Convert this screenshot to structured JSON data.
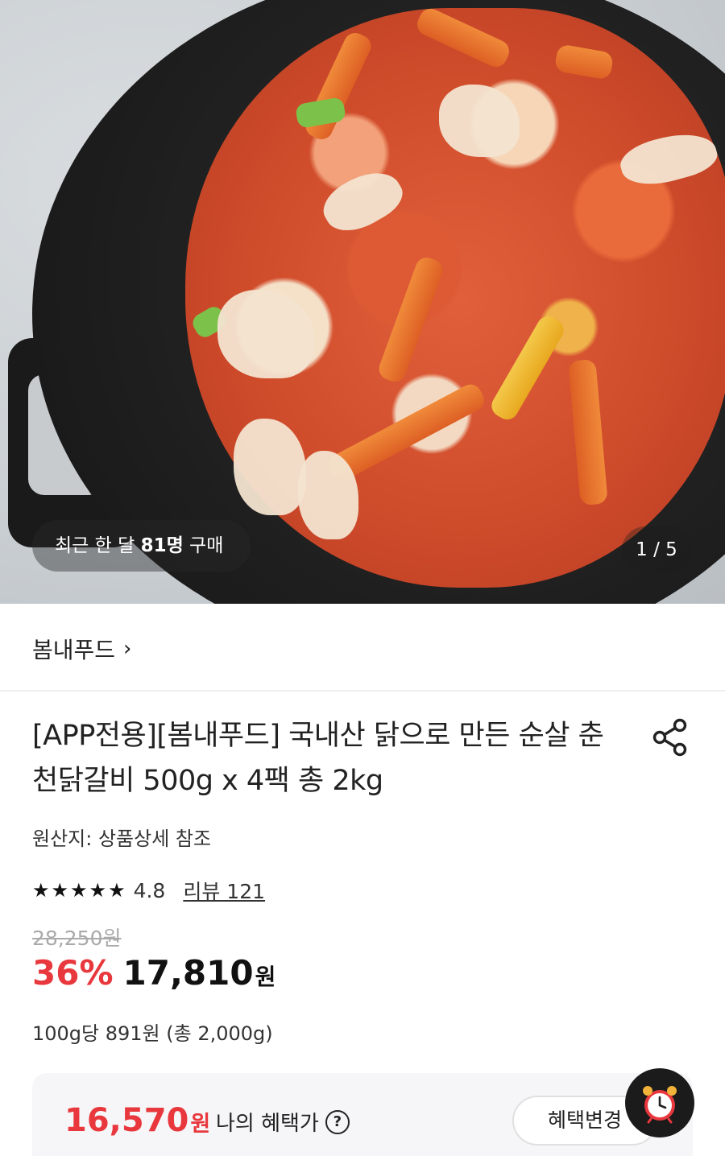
{
  "gallery": {
    "buyers_prefix": "최근 한 달 ",
    "buyers_count": "81명",
    "buyers_suffix": " 구매",
    "page_indicator": "1 / 5"
  },
  "seller": {
    "name": "봄내푸드",
    "chevron": "›"
  },
  "product": {
    "title": "[APP전용][봄내푸드] 국내산 닭으로 만든 순살 춘천닭갈비 500g x 4팩 총 2kg",
    "origin": "원산지: 상품상세 참조",
    "rating": {
      "stars": "★★★★★",
      "score": "4.8",
      "review_label": "리뷰 121"
    },
    "original_price": "28,250원",
    "discount": "36%",
    "price": "17,810",
    "price_unit": "원",
    "unit_price": "100g당 891원 (총 2,000g)"
  },
  "benefit": {
    "price": "16,570",
    "price_unit": "원",
    "label": "나의 혜택가",
    "help_icon": "?",
    "change_button": "혜택변경"
  },
  "icons": {
    "share": "share-icon",
    "timer": "alarm-clock-icon"
  },
  "colors": {
    "accent_red": "#e8383d"
  }
}
